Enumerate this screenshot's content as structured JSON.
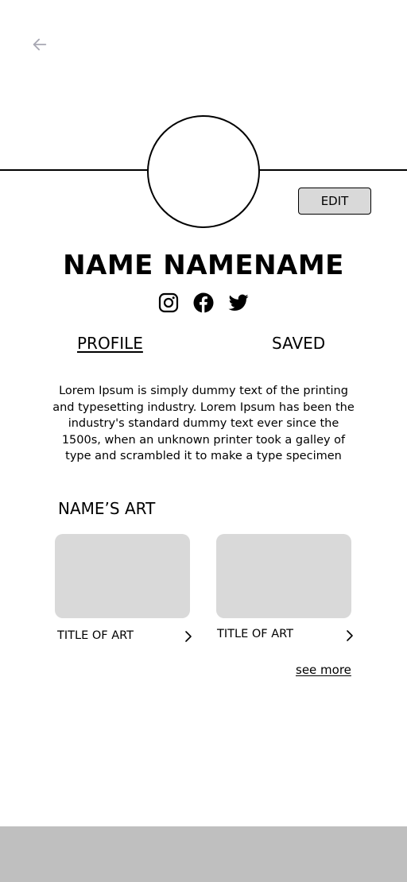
{
  "header": {
    "back_icon": "arrow-left-icon"
  },
  "profile": {
    "name": "NAME NAMENAME",
    "edit_label": "EDIT",
    "social": [
      {
        "name": "Instagram",
        "icon": "instagram-icon"
      },
      {
        "name": "Facebook",
        "icon": "facebook-icon"
      },
      {
        "name": "Twitter",
        "icon": "twitter-icon"
      }
    ]
  },
  "tabs": [
    {
      "label": "PROFILE",
      "active": true
    },
    {
      "label": "SAVED",
      "active": false
    }
  ],
  "bio": "Lorem Ipsum is simply dummy text of the printing and typesetting industry. Lorem Ipsum has been the industry's standard dummy text ever since the 1500s, when an unknown printer took a galley of type and scrambled it to make a type specimen",
  "art_section": {
    "title": "NAME’S ART",
    "items": [
      {
        "title": "TITLE OF ART"
      },
      {
        "title": "TITLE OF ART"
      }
    ],
    "see_more": "see more"
  },
  "colors": {
    "back_icon": "#a8a8b3",
    "placeholder": "#d9d9d9",
    "bottom_bar": "#bfbfbf"
  }
}
